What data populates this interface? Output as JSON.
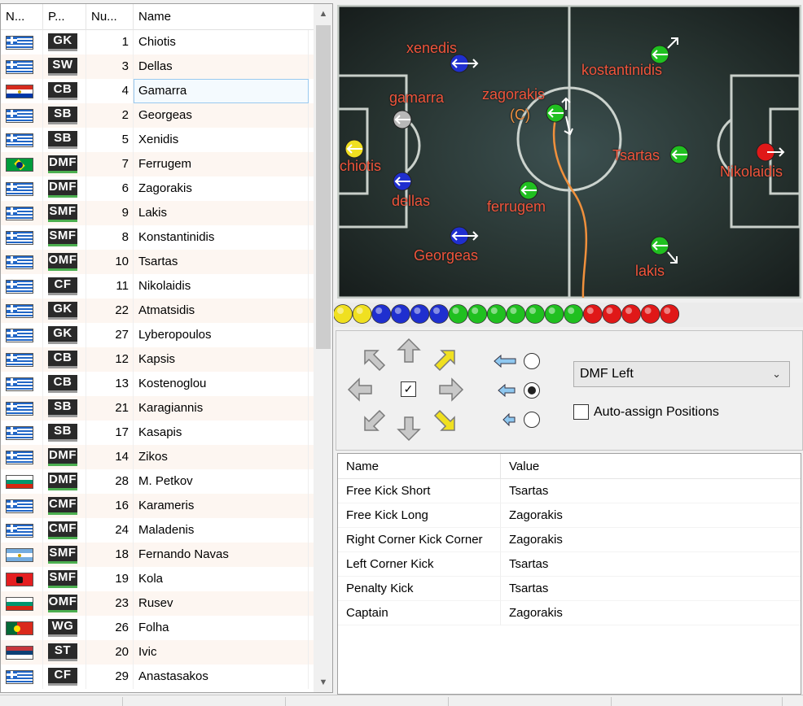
{
  "list_header": {
    "flag": "N...",
    "position": "P...",
    "number": "Nu...",
    "name": "Name"
  },
  "players": [
    {
      "flag": "greece",
      "pos": "GK",
      "num": "1",
      "name": "Chiotis"
    },
    {
      "flag": "greece",
      "pos": "SW",
      "num": "3",
      "name": "Dellas"
    },
    {
      "flag": "paraguay",
      "pos": "CB",
      "num": "4",
      "name": "Gamarra"
    },
    {
      "flag": "greece",
      "pos": "SB",
      "num": "2",
      "name": "Georgeas"
    },
    {
      "flag": "greece",
      "pos": "SB",
      "num": "5",
      "name": "Xenidis"
    },
    {
      "flag": "brazil",
      "pos": "DMF",
      "num": "7",
      "name": "Ferrugem"
    },
    {
      "flag": "greece",
      "pos": "DMF",
      "num": "6",
      "name": "Zagorakis"
    },
    {
      "flag": "greece",
      "pos": "SMF",
      "num": "9",
      "name": "Lakis"
    },
    {
      "flag": "greece",
      "pos": "SMF",
      "num": "8",
      "name": "Konstantinidis"
    },
    {
      "flag": "greece",
      "pos": "OMF",
      "num": "10",
      "name": "Tsartas"
    },
    {
      "flag": "greece",
      "pos": "CF",
      "num": "11",
      "name": "Nikolaidis"
    },
    {
      "flag": "greece",
      "pos": "GK",
      "num": "22",
      "name": "Atmatsidis"
    },
    {
      "flag": "greece",
      "pos": "GK",
      "num": "27",
      "name": "Lyberopoulos"
    },
    {
      "flag": "greece",
      "pos": "CB",
      "num": "12",
      "name": "Kapsis"
    },
    {
      "flag": "greece",
      "pos": "CB",
      "num": "13",
      "name": "Kostenoglou"
    },
    {
      "flag": "greece",
      "pos": "SB",
      "num": "21",
      "name": "Karagiannis"
    },
    {
      "flag": "greece",
      "pos": "SB",
      "num": "17",
      "name": "Kasapis"
    },
    {
      "flag": "greece",
      "pos": "DMF",
      "num": "14",
      "name": "Zikos"
    },
    {
      "flag": "bulgaria",
      "pos": "DMF",
      "num": "28",
      "name": "M. Petkov"
    },
    {
      "flag": "greece",
      "pos": "CMF",
      "num": "16",
      "name": "Karameris"
    },
    {
      "flag": "greece",
      "pos": "CMF",
      "num": "24",
      "name": "Maladenis"
    },
    {
      "flag": "argentina",
      "pos": "SMF",
      "num": "18",
      "name": "Fernando Navas"
    },
    {
      "flag": "albania",
      "pos": "SMF",
      "num": "19",
      "name": "Kola"
    },
    {
      "flag": "bulgaria",
      "pos": "OMF",
      "num": "23",
      "name": "Rusev"
    },
    {
      "flag": "portugal",
      "pos": "WG",
      "num": "26",
      "name": "Folha"
    },
    {
      "flag": "serbia",
      "pos": "ST",
      "num": "20",
      "name": "Ivic"
    },
    {
      "flag": "greece",
      "pos": "CF",
      "num": "29",
      "name": "Anastasakos"
    }
  ],
  "selected_player": "Gamarra",
  "pitch_labels": {
    "xenedis": "xenedis",
    "gamarra": "gamarra",
    "chiotis": "chiotis",
    "dellas": "dellas",
    "georgeas": "Georgeas",
    "zagorakis": "zagorakis",
    "captain_mark": "(C)",
    "ferrugem": "ferrugem",
    "kostantinidis": "kostantinidis",
    "tsartas": "Tsartas",
    "nikolaidis": "Nikolaidis",
    "lakis": "lakis"
  },
  "ball_colors": [
    "yellow",
    "yellow",
    "blue",
    "blue",
    "blue",
    "blue",
    "green",
    "green",
    "green",
    "green",
    "green",
    "green",
    "green",
    "red",
    "red",
    "red",
    "red",
    "red"
  ],
  "controls": {
    "position_select": "DMF Left",
    "auto_assign_label": "Auto-assign Positions",
    "auto_assign_checked": false,
    "center_checked": true,
    "selected_radio": "medium"
  },
  "setpieces_header": {
    "name": "Name",
    "value": "Value"
  },
  "setpieces": [
    {
      "name": "Free Kick Short",
      "value": "Tsartas"
    },
    {
      "name": "Free Kick Long",
      "value": "Zagorakis"
    },
    {
      "name": "Right Corner Kick Corner",
      "value": "Zagorakis"
    },
    {
      "name": "Left Corner Kick",
      "value": "Tsartas"
    },
    {
      "name": "Penalty Kick",
      "value": "Tsartas"
    },
    {
      "name": "Captain",
      "value": "Zagorakis"
    }
  ],
  "colors": {
    "label_red": "#f0553c",
    "captain_orange": "#f09040",
    "ball_yellow": "#f0e020",
    "ball_blue": "#1f2fcf",
    "ball_green": "#20c020",
    "ball_red": "#e01818",
    "selected_outline": "#99c9ef"
  },
  "icons": [
    "chevron-up-icon",
    "chevron-down-icon",
    "dropdown-chevron-icon",
    "arrow-up-icon",
    "arrow-down-icon",
    "arrow-left-icon",
    "arrow-right-icon",
    "arrow-up-left-icon",
    "arrow-up-right-icon",
    "arrow-down-left-icon",
    "arrow-down-right-icon",
    "checkbox-icon"
  ]
}
